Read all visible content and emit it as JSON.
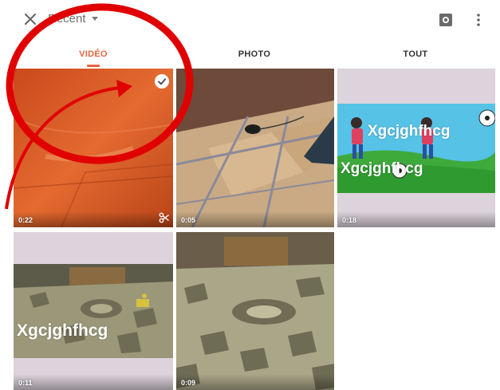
{
  "header": {
    "close_icon": "close-icon",
    "album_label": "Récent",
    "camera_icon": "camera-icon",
    "more_icon": "more-vert-icon"
  },
  "tabs": [
    {
      "label": "VIDÉO",
      "active": true
    },
    {
      "label": "PHOTO",
      "active": false
    },
    {
      "label": "TOUT",
      "active": false
    }
  ],
  "colors": {
    "accent": "#e8643c",
    "annotation_red": "#e00000"
  },
  "media": [
    {
      "type": "video",
      "duration": "0:22",
      "selected": true,
      "trim_icon": "scissors-icon"
    },
    {
      "type": "video",
      "duration": "0:05",
      "selected": false
    },
    {
      "type": "video",
      "duration": "0:18",
      "selected": false,
      "overlay_text": [
        "Xgcjghfhcg",
        "Xgcjghfhcg"
      ]
    },
    {
      "type": "video",
      "duration": "0:11",
      "selected": false,
      "overlay_text": [
        "Xgcjghfhcg"
      ]
    },
    {
      "type": "video",
      "duration": "0:09",
      "selected": false
    }
  ]
}
